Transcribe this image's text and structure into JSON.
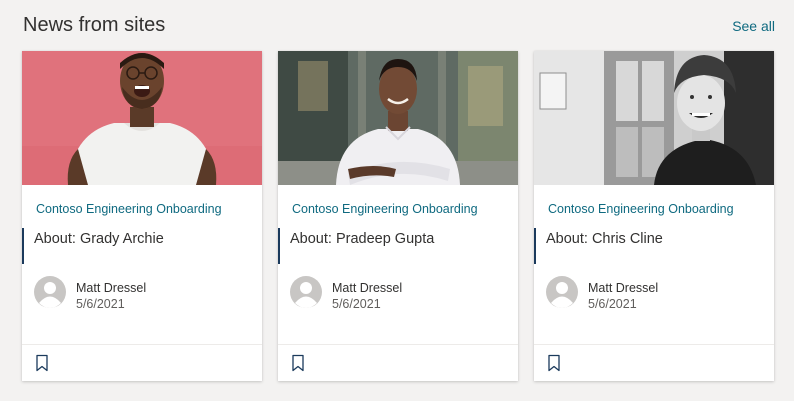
{
  "section": {
    "title": "News from sites",
    "see_all": "See all"
  },
  "colors": {
    "accent": "#0f6a80",
    "title_bar": "#1b3a5c",
    "card_bg": "#ffffff",
    "page_bg": "#f3f2f1"
  },
  "cards": [
    {
      "site": "Contoso Engineering Onboarding",
      "title": "About: Grady Archie",
      "author": "Matt Dressel",
      "date": "5/6/2021",
      "icons": {
        "avatar": "person-avatar-icon",
        "bookmark": "bookmark-icon"
      }
    },
    {
      "site": "Contoso Engineering Onboarding",
      "title": "About: Pradeep Gupta",
      "author": "Matt Dressel",
      "date": "5/6/2021",
      "icons": {
        "avatar": "person-avatar-icon",
        "bookmark": "bookmark-icon"
      }
    },
    {
      "site": "Contoso Engineering Onboarding",
      "title": "About: Chris Cline",
      "author": "Matt Dressel",
      "date": "5/6/2021",
      "icons": {
        "avatar": "person-avatar-icon",
        "bookmark": "bookmark-icon"
      }
    }
  ]
}
